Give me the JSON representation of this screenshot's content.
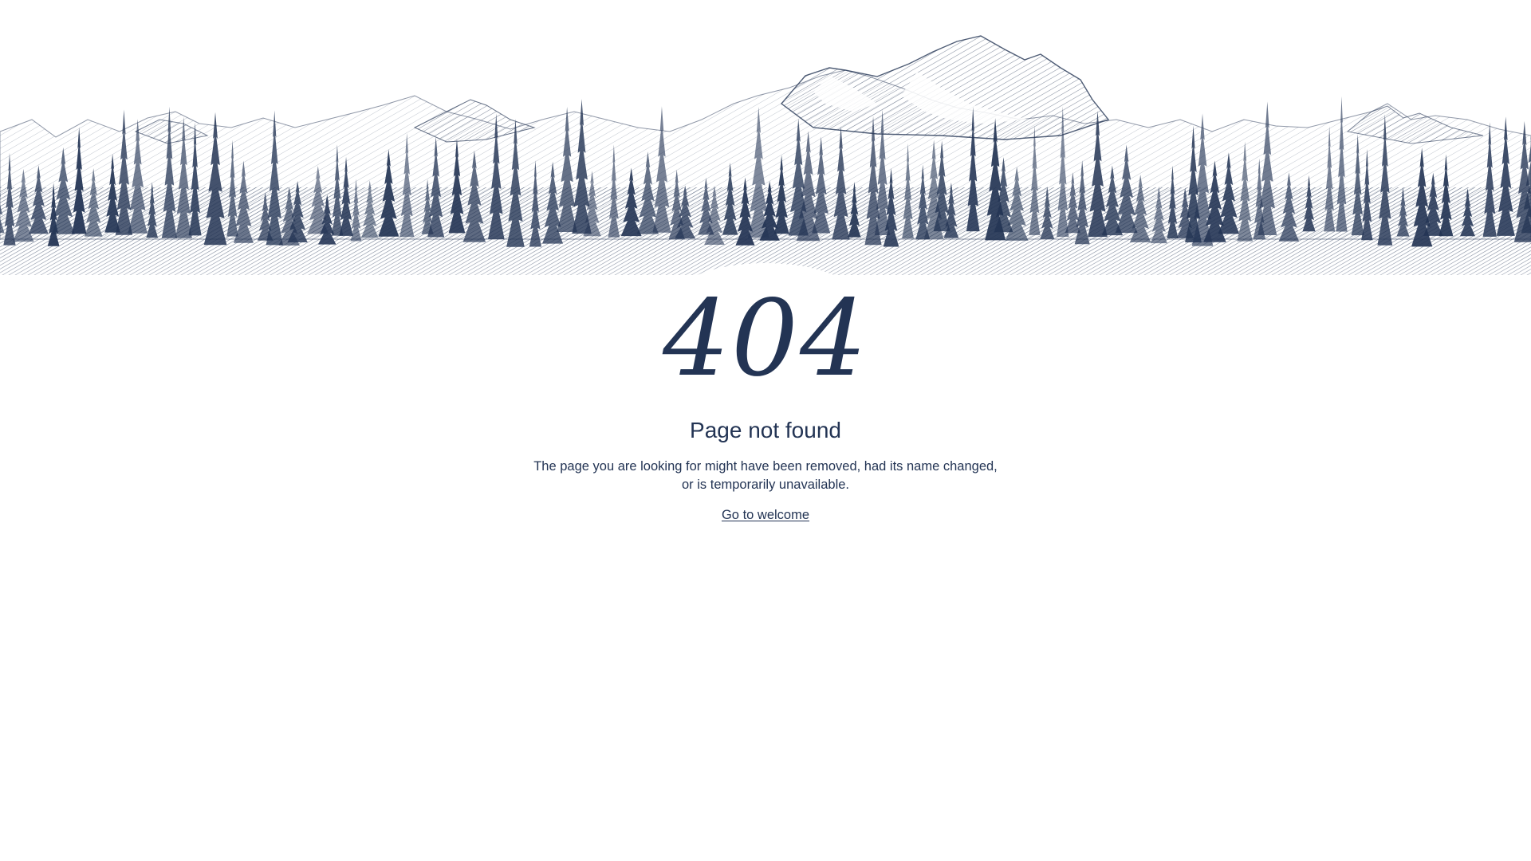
{
  "illustration": {
    "name": "mountain-forest-illustration",
    "colors": {
      "ink": "#233454",
      "snow": "#ffffff"
    }
  },
  "error": {
    "code": "404",
    "title": "Page not found",
    "message_line1": "The page you are looking for might have been removed, had its name changed,",
    "message_line2": "or is temporarily unavailable.",
    "link_label": "Go to welcome"
  },
  "theme": {
    "text_color": "#233454",
    "background": "#ffffff"
  }
}
